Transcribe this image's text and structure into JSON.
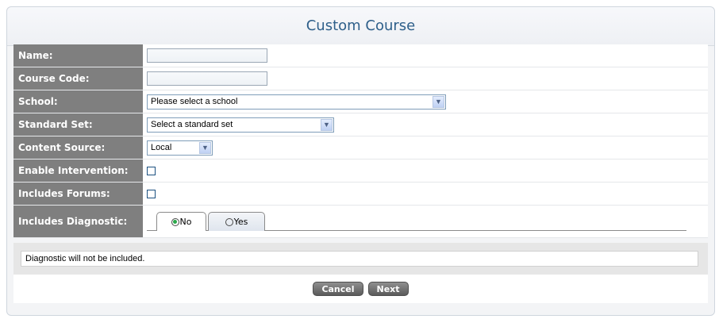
{
  "title": "Custom Course",
  "fields": {
    "name": {
      "label": "Name:",
      "value": ""
    },
    "course_code": {
      "label": "Course Code:",
      "value": ""
    },
    "school": {
      "label": "School:",
      "selected": "Please select a school"
    },
    "standard_set": {
      "label": "Standard Set:",
      "selected": "Select a standard set"
    },
    "content_source": {
      "label": "Content Source:",
      "selected": "Local"
    },
    "enable_intervention": {
      "label": "Enable Intervention:",
      "checked": false
    },
    "includes_forums": {
      "label": "Includes Forums:",
      "checked": false
    },
    "includes_diagnostic": {
      "label": "Includes Diagnostic:",
      "tabs": [
        {
          "label": "No",
          "selected": true
        },
        {
          "label": "Yes",
          "selected": false
        }
      ]
    }
  },
  "diagnostic_message": "Diagnostic will not be included.",
  "buttons": {
    "cancel": "Cancel",
    "next": "Next"
  },
  "colors": {
    "label_bg": "#7f7f7f",
    "title_text": "#2e5f8a",
    "button_bg": "#6a6a6a",
    "radio_selected": "#2aa84a"
  }
}
